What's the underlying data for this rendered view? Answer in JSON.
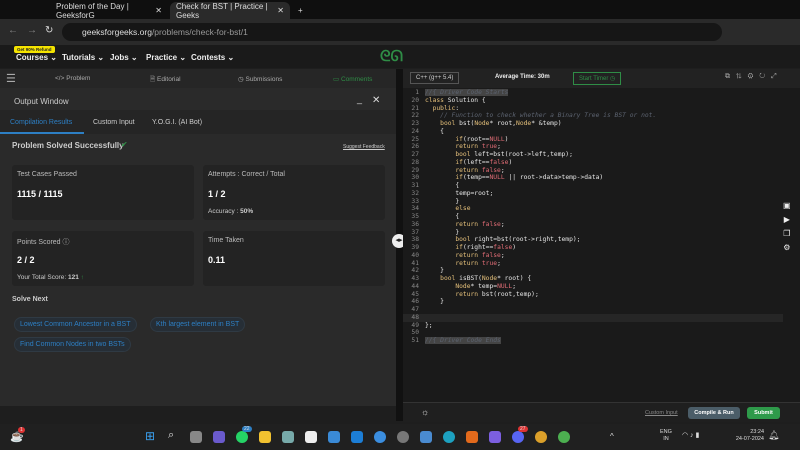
{
  "browser": {
    "tabs": [
      {
        "title": "Problem of the Day | GeeksforG",
        "active": false
      },
      {
        "title": "Check for BST | Practice | Geeks",
        "active": true
      }
    ],
    "new_tab": "+",
    "url_domain": "geeksforgeeks.org",
    "url_path": "/problems/check-for-bst/1"
  },
  "nav": {
    "badge": "Get 90% Refund",
    "items": [
      "Courses ⌄",
      "Tutorials ⌄",
      "Jobs ⌄",
      "Practice ⌄",
      "Contests ⌄"
    ]
  },
  "problem_tabs": [
    "</> Problem",
    "🗎 Editorial",
    "◷ Submissions",
    "▭ Comments"
  ],
  "output": {
    "title": "Output Window",
    "tabs": [
      "Compilation Results",
      "Custom Input",
      "Y.O.G.I. (AI Bot)"
    ],
    "status": "Problem Solved Successfully",
    "suggest": "Suggest Feedback",
    "cards": [
      {
        "label": "Test Cases Passed",
        "value": "1115 / 1115"
      },
      {
        "label": "Attempts : Correct / Total",
        "value": "1 / 2",
        "sub_label": "Accuracy :",
        "sub_value": "50%"
      },
      {
        "label": "Points Scored",
        "value": "2 / 2",
        "sub_label": "Your Total Score:",
        "sub_value": "121"
      },
      {
        "label": "Time Taken",
        "value": "0.11"
      }
    ],
    "solve_next": "Solve Next",
    "next": [
      "Lowest Common Ancestor in a BST",
      "Kth largest element in BST",
      "Find Common Nodes in two BSTs"
    ]
  },
  "editor": {
    "language": "C++ (g++ 5.4)",
    "avg_time": "Average Time: 30m",
    "start_timer": "Start Timer ◷",
    "code": [
      {
        "n": "1",
        "t": "//{ Driver Code Starts",
        "fold": true
      },
      {
        "n": "20",
        "t": "class Solution {"
      },
      {
        "n": "21",
        "t": "  public:"
      },
      {
        "n": "22",
        "t": "    // Function to check whether a Binary Tree is BST or not."
      },
      {
        "n": "23",
        "t": "    bool bst(Node* root,Node* &temp)"
      },
      {
        "n": "24",
        "t": "    {"
      },
      {
        "n": "25",
        "t": "        if(root==NULL)"
      },
      {
        "n": "26",
        "t": "        return true;"
      },
      {
        "n": "27",
        "t": "        bool left=bst(root->left,temp);"
      },
      {
        "n": "28",
        "t": "        if(left==false)"
      },
      {
        "n": "29",
        "t": "        return false;"
      },
      {
        "n": "30",
        "t": "        if(temp==NULL || root->data>temp->data)"
      },
      {
        "n": "31",
        "t": "        {"
      },
      {
        "n": "32",
        "t": "        temp=root;"
      },
      {
        "n": "33",
        "t": "        }"
      },
      {
        "n": "34",
        "t": "        else"
      },
      {
        "n": "35",
        "t": "        {"
      },
      {
        "n": "36",
        "t": "        return false;"
      },
      {
        "n": "37",
        "t": "        }"
      },
      {
        "n": "38",
        "t": "        bool right=bst(root->right,temp);"
      },
      {
        "n": "39",
        "t": "        if(right==false)"
      },
      {
        "n": "40",
        "t": "        return false;"
      },
      {
        "n": "41",
        "t": "        return true;"
      },
      {
        "n": "42",
        "t": "    }"
      },
      {
        "n": "43",
        "t": "    bool isBST(Node* root) {"
      },
      {
        "n": "44",
        "t": "        Node* temp=NULL;"
      },
      {
        "n": "45",
        "t": "        return bst(root,temp);"
      },
      {
        "n": "46",
        "t": "    }"
      },
      {
        "n": "47",
        "t": ""
      },
      {
        "n": "48",
        "t": ""
      },
      {
        "n": "49",
        "t": "};"
      },
      {
        "n": "50",
        "t": ""
      },
      {
        "n": "51",
        "t": "//{ Driver Code Ends",
        "fold": true
      }
    ],
    "custom_input": "Custom Input",
    "compile": "Compile & Run",
    "submit": "Submit"
  },
  "taskbar": {
    "lang": "ENG",
    "region": "IN",
    "time": "23:24",
    "date": "24-07-2024",
    "badges": [
      "1",
      "22",
      "27"
    ]
  },
  "colors": {
    "accent": "#2f8d46",
    "link": "#2d7fc4",
    "submit": "#2e9a4a",
    "compile": "#4b5d68"
  }
}
